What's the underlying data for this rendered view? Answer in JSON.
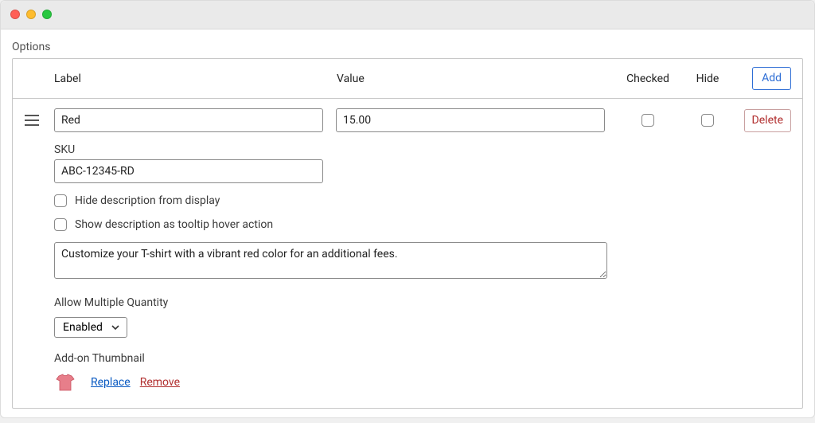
{
  "section_title": "Options",
  "header": {
    "label": "Label",
    "value": "Value",
    "checked": "Checked",
    "hide": "Hide",
    "add": "Add"
  },
  "row": {
    "label_value": "Red",
    "value_value": "15.00",
    "delete": "Delete"
  },
  "sku": {
    "label": "SKU",
    "value": "ABC-12345-RD"
  },
  "opts": {
    "hide_desc": "Hide description from display",
    "tooltip_desc": "Show description as tooltip hover action"
  },
  "description": "Customize your T-shirt with a vibrant red color for an additional fees.",
  "allow_multiple": {
    "label": "Allow Multiple Quantity",
    "selected": "Enabled"
  },
  "thumbnail": {
    "label": "Add-on Thumbnail",
    "replace": "Replace",
    "remove": "Remove"
  },
  "colors": {
    "accent": "#2e6ed5",
    "danger": "#b12f2f"
  }
}
